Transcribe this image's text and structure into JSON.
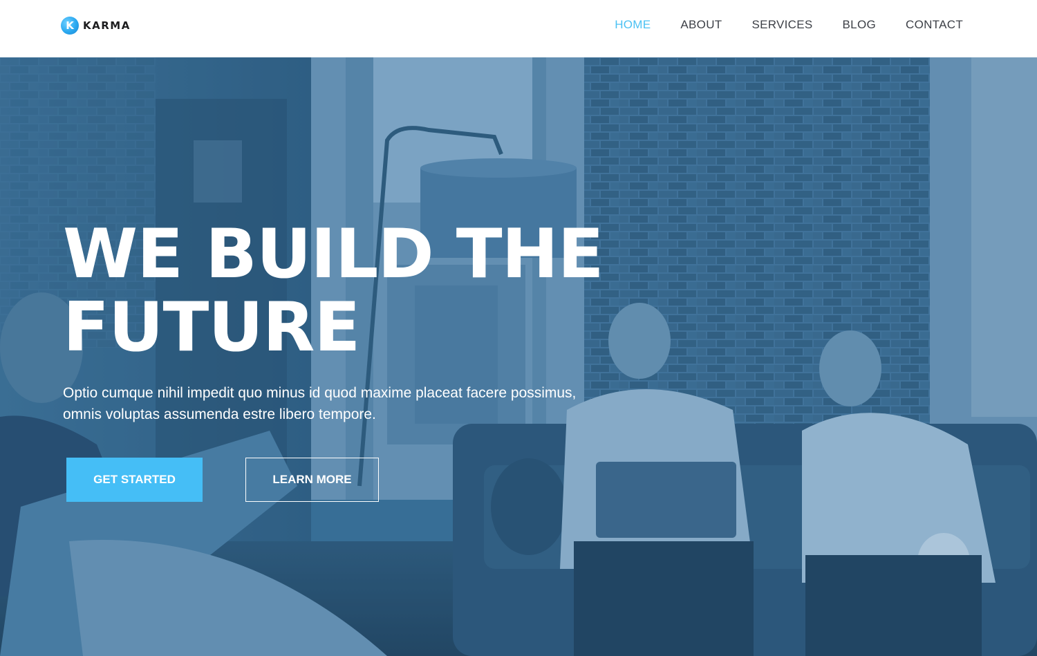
{
  "brand": {
    "logo_letter": "K",
    "name": "KARMA",
    "accent_color": "#45bef6"
  },
  "nav": {
    "items": [
      {
        "label": "HOME",
        "active": true
      },
      {
        "label": "ABOUT",
        "active": false
      },
      {
        "label": "SERVICES",
        "active": false
      },
      {
        "label": "BLOG",
        "active": false
      },
      {
        "label": "CONTACT",
        "active": false
      }
    ]
  },
  "hero": {
    "title_line1": "WE BUILD THE",
    "title_line2": "FUTURE",
    "subtitle_line1": "Optio cumque nihil impedit quo minus id quod maxime placeat facere possimus,",
    "subtitle_line2": "omnis voluptas assumenda estre libero tempore.",
    "primary_button": "GET STARTED",
    "secondary_button": "LEARN MORE",
    "overlay_color": "#3a6f95"
  }
}
